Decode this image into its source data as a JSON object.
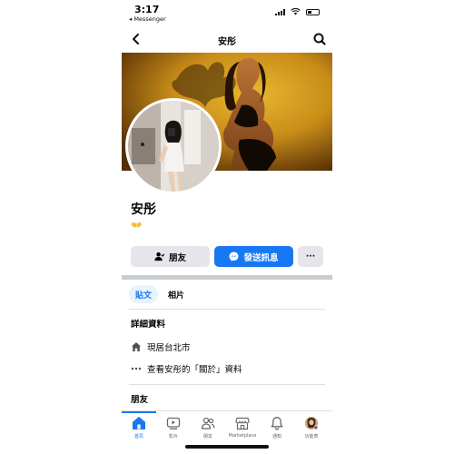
{
  "status_bar": {
    "time": "3:17",
    "back_app": "◂ Messenger"
  },
  "nav": {
    "title": "安彤",
    "back_icon": "chevron-left-icon",
    "search_icon": "search-icon"
  },
  "profile": {
    "name": "安彤",
    "emoji": "👐"
  },
  "actions": {
    "friends_label": "朋友",
    "message_label": "發送訊息",
    "more_label": "···"
  },
  "tabs": {
    "posts": "貼文",
    "photos": "相片"
  },
  "details": {
    "title": "詳細資料",
    "location": "現居台北市",
    "about_link": "查看安彤的「關於」資料"
  },
  "friends_section": {
    "title": "朋友"
  },
  "tab_bar": {
    "items": [
      {
        "label": "首頁",
        "icon": "home-icon"
      },
      {
        "label": "影片",
        "icon": "video-icon"
      },
      {
        "label": "朋友",
        "icon": "friends-icon"
      },
      {
        "label": "Marketplace",
        "icon": "marketplace-icon"
      },
      {
        "label": "通知",
        "icon": "bell-icon"
      },
      {
        "label": "功能表",
        "icon": "menu-avatar-icon"
      }
    ]
  },
  "colors": {
    "accent": "#1877f2",
    "button_gray": "#e4e6eb",
    "cover_gold": "#e0a21a"
  }
}
